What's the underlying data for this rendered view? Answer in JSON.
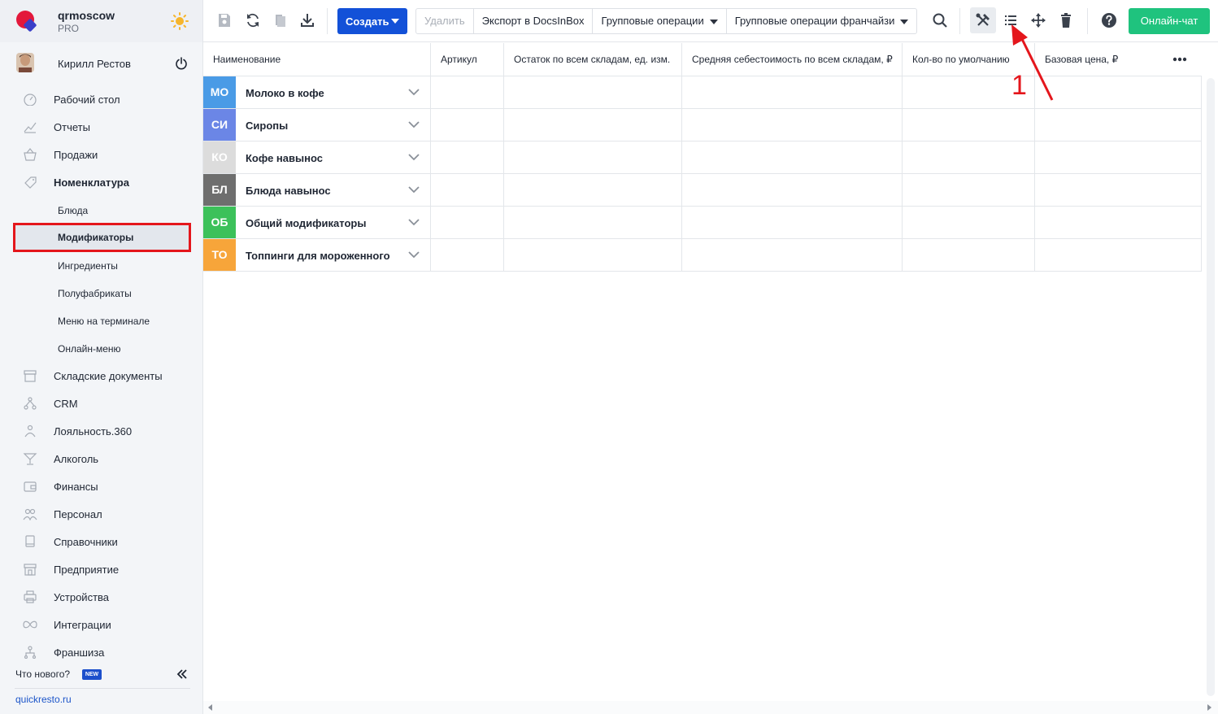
{
  "brand": {
    "name": "qrmoscow",
    "plan": "PRO"
  },
  "user": {
    "name": "Кирилл Рестов"
  },
  "sidebar": {
    "items": [
      {
        "label": "Рабочий стол",
        "icon": "dashboard-icon"
      },
      {
        "label": "Отчеты",
        "icon": "chart-icon"
      },
      {
        "label": "Продажи",
        "icon": "basket-icon"
      },
      {
        "label": "Номенклатура",
        "icon": "tag-icon"
      }
    ],
    "subitems": [
      {
        "label": "Блюда"
      },
      {
        "label": "Модификаторы"
      },
      {
        "label": "Ингредиенты"
      },
      {
        "label": "Полуфабрикаты"
      },
      {
        "label": "Меню на терминале"
      },
      {
        "label": "Онлайн-меню"
      }
    ],
    "items_after": [
      {
        "label": "Складские документы",
        "icon": "warehouse-icon"
      },
      {
        "label": "CRM",
        "icon": "hierarchy-icon"
      },
      {
        "label": "Лояльность.360",
        "icon": "loyalty-icon"
      },
      {
        "label": "Алкоголь",
        "icon": "cocktail-icon"
      },
      {
        "label": "Финансы",
        "icon": "wallet-icon"
      },
      {
        "label": "Персонал",
        "icon": "people-icon"
      },
      {
        "label": "Справочники",
        "icon": "book-icon"
      },
      {
        "label": "Предприятие",
        "icon": "store-icon"
      },
      {
        "label": "Устройства",
        "icon": "printer-icon"
      },
      {
        "label": "Интеграции",
        "icon": "infinity-icon"
      },
      {
        "label": "Франшиза",
        "icon": "franchise-icon"
      }
    ],
    "whats_new": "Что нового?",
    "new_badge": "NEW",
    "site_link": "quickresto.ru"
  },
  "toolbar": {
    "create_label": "Создать",
    "delete_label": "Удалить",
    "export_label": "Экспорт в DocsInBox",
    "group_ops_label": "Групповые операции",
    "group_ops_franchise_label": "Групповые операции франчайзи",
    "chat_label": "Онлайн-чат",
    "colors": {
      "create": "#1351d8",
      "chat": "#1fc37e"
    }
  },
  "table": {
    "columns": [
      "Наименование",
      "Артикул",
      "Остаток по всем складам, ед. изм.",
      "Средняя себестоимость по всем складам, ₽",
      "Кол-во по умолчанию",
      "Базовая цена, ₽"
    ],
    "rows": [
      {
        "abbr": "МО",
        "name": "Молоко в кофе",
        "color": "#4a9be6"
      },
      {
        "abbr": "СИ",
        "name": "Сиропы",
        "color": "#6b86e6"
      },
      {
        "abbr": "КО",
        "name": "Кофе навынос",
        "color": "#dcdcdc"
      },
      {
        "abbr": "БЛ",
        "name": "Блюда навынос",
        "color": "#6e6e6e"
      },
      {
        "abbr": "ОБ",
        "name": "Общий модификаторы",
        "color": "#3cc15a"
      },
      {
        "abbr": "ТО",
        "name": "Топпинги для мороженного",
        "color": "#f7a53a"
      }
    ]
  },
  "annotation": {
    "number": "1",
    "color": "#e4161c"
  }
}
